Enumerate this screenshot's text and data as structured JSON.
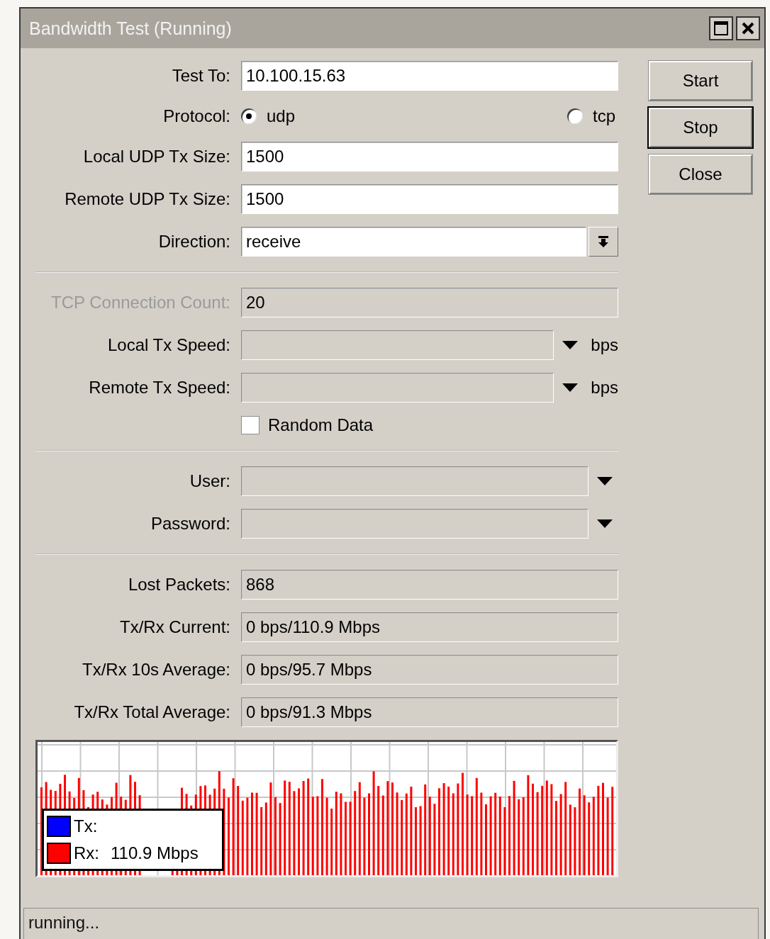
{
  "window": {
    "title": "Bandwidth Test (Running)"
  },
  "fields": [
    {
      "kind": "text",
      "label": "Test To:",
      "value": "10.100.15.63",
      "disabled": false
    },
    {
      "kind": "radio",
      "label": "Protocol:",
      "options": [
        {
          "label": "udp",
          "selected": true
        },
        {
          "label": "tcp",
          "selected": false
        }
      ]
    },
    {
      "kind": "text",
      "label": "Local UDP Tx Size:",
      "value": "1500",
      "disabled": false
    },
    {
      "kind": "text",
      "label": "Remote UDP Tx Size:",
      "value": "1500",
      "disabled": false
    },
    {
      "kind": "select",
      "label": "Direction:",
      "value": "receive"
    },
    {
      "kind": "divider"
    },
    {
      "kind": "text",
      "label": "TCP Connection Count:",
      "value": "20",
      "disabled": true
    },
    {
      "kind": "speed",
      "label": "Local Tx Speed:",
      "unit": "bps"
    },
    {
      "kind": "speed",
      "label": "Remote Tx Speed:",
      "unit": "bps"
    },
    {
      "kind": "checkbox",
      "label": "Random Data",
      "checked": false
    },
    {
      "kind": "divider"
    },
    {
      "kind": "combo",
      "label": "User:"
    },
    {
      "kind": "combo",
      "label": "Password:"
    },
    {
      "kind": "divider"
    },
    {
      "kind": "readout",
      "label": "Lost Packets:",
      "value": "868"
    },
    {
      "kind": "readout",
      "label": "Tx/Rx Current:",
      "value": "0 bps/110.9 Mbps"
    },
    {
      "kind": "readout",
      "label": "Tx/Rx 10s Average:",
      "value": "0 bps/95.7 Mbps"
    },
    {
      "kind": "readout",
      "label": "Tx/Rx Total Average:",
      "value": "0 bps/91.3 Mbps"
    }
  ],
  "buttons": [
    {
      "label": "Start",
      "focused": false
    },
    {
      "label": "Stop",
      "focused": true
    },
    {
      "label": "Close",
      "focused": false
    }
  ],
  "graph": {
    "legend": [
      {
        "name": "Tx:",
        "color": "#0000ff"
      },
      {
        "name": "Rx:",
        "reading": "110.9 Mbps",
        "color": "#ff0000"
      }
    ]
  },
  "status_bar": "running..."
}
